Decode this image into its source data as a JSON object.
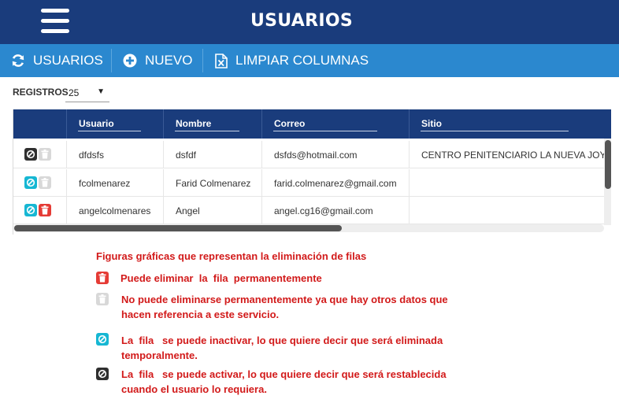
{
  "header": {
    "title": "USUARIOS",
    "menu_icon": "hamburger-menu-icon"
  },
  "toolbar": {
    "refresh_label": "USUARIOS",
    "new_label": "NUEVO",
    "clear_label": "LIMPIAR COLUMNAS",
    "color": "#2b88cf"
  },
  "registros": {
    "label": "REGISTROS",
    "value": "25"
  },
  "table": {
    "columns": [
      "Usuario",
      "Nombre",
      "Correo",
      "Sitio"
    ],
    "rows": [
      {
        "usuario": "dfdsfs",
        "nombre": "dsfdf",
        "correo": "dsfds@hotmail.com",
        "sitio": "CENTRO PENITENCIARIO LA NUEVA JOYA",
        "status_icon": "activate-icon",
        "delete_icon": "delete-disabled-icon"
      },
      {
        "usuario": "fcolmenarez",
        "nombre": "Farid Colmenarez",
        "correo": "farid.colmenarez@gmail.com",
        "sitio": "",
        "status_icon": "inactivate-icon",
        "delete_icon": "delete-disabled-icon"
      },
      {
        "usuario": "angelcolmenares",
        "nombre": "Angel",
        "correo": "angel.cg16@gmail.com",
        "sitio": "",
        "status_icon": "inactivate-icon",
        "delete_icon": "delete-icon"
      }
    ]
  },
  "legend": {
    "title": "Figuras gráficas que representan la eliminación de filas",
    "items": [
      {
        "icon": "delete-icon",
        "text": "Puede eliminar  la  fila  permanentemente"
      },
      {
        "icon": "delete-disabled-icon",
        "text": "No puede eliminarse permanentemente ya que hay otros datos que\nhacen referencia a este servicio."
      },
      {
        "icon": "inactivate-icon",
        "text": "La  fila   se puede inactivar, lo que quiere decir que será eliminada\ntemporalmente."
      },
      {
        "icon": "activate-icon",
        "text": "La  fila   se puede activar, lo que quiere decir que será restablecida\ncuando el usuario lo requiera."
      }
    ]
  },
  "colors": {
    "header": "#1a3c7c",
    "legend_text": "#d21a1a",
    "delete": "#e53b35",
    "inactivate": "#16b7d3",
    "activate": "#2f2f2f",
    "disabled": "#d8d8d8"
  }
}
